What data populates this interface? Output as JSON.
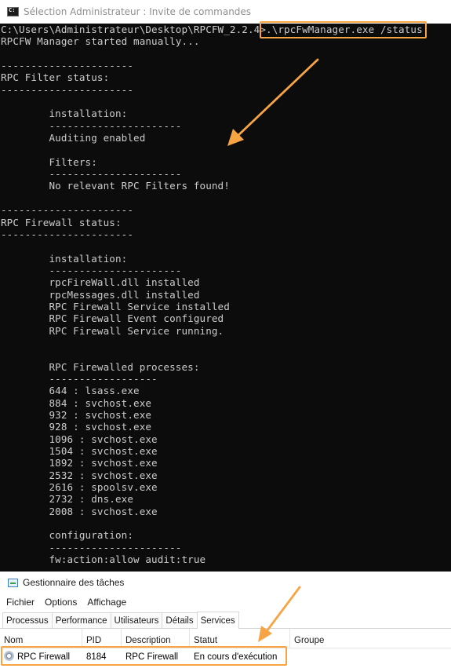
{
  "cmd": {
    "title": "Sélection Administrateur : Invite de commandes",
    "lines": [
      "C:\\Users\\Administrateur\\Desktop\\RPCFW_2.2.4>.\\rpcFwManager.exe /status",
      "RPCFW Manager started manually...",
      "",
      "----------------------",
      "RPC Filter status:",
      "----------------------",
      "",
      "        installation:",
      "        ----------------------",
      "        Auditing enabled",
      "",
      "        Filters:",
      "        ----------------------",
      "        No relevant RPC Filters found!",
      "",
      "----------------------",
      "RPC Firewall status:",
      "----------------------",
      "",
      "        installation:",
      "        ----------------------",
      "        rpcFireWall.dll installed",
      "        rpcMessages.dll installed",
      "        RPC Firewall Service installed",
      "        RPC Firewall Event configured",
      "        RPC Firewall Service running.",
      "",
      "",
      "        RPC Firewalled processes:",
      "        ------------------",
      "        644 : lsass.exe",
      "        884 : svchost.exe",
      "        932 : svchost.exe",
      "        928 : svchost.exe",
      "        1096 : svchost.exe",
      "        1504 : svchost.exe",
      "        1892 : svchost.exe",
      "        2532 : svchost.exe",
      "        2616 : spoolsv.exe",
      "        2732 : dns.exe",
      "        2008 : svchost.exe",
      "",
      "        configuration:",
      "        ----------------------",
      "        fw:action:allow audit:true",
      ""
    ]
  },
  "taskmanager": {
    "title": "Gestionnaire des tâches",
    "menu": [
      "Fichier",
      "Options",
      "Affichage"
    ],
    "tabs": [
      "Processus",
      "Performance",
      "Utilisateurs",
      "Détails",
      "Services"
    ],
    "active_tab": "Services",
    "columns": {
      "name": "Nom",
      "pid": "PID",
      "description": "Description",
      "status": "Statut",
      "group": "Groupe"
    },
    "rows": [
      {
        "name": "RPC Firewall",
        "pid": "8184",
        "description": "RPC Firewall",
        "status": "En cours d'exécution",
        "group": ""
      }
    ]
  },
  "colors": {
    "highlight": "#f7a445",
    "console_bg": "#0c0c0c",
    "console_text": "#cccccc"
  },
  "icons": [
    "cmd-icon",
    "task-manager-icon",
    "service-gear-icon"
  ]
}
